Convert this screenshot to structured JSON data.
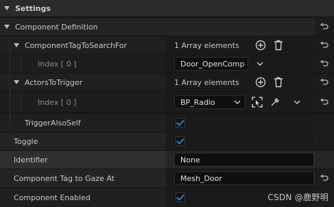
{
  "settings": {
    "title": "Settings"
  },
  "rows": {
    "component_definition": {
      "label": "Component Definition"
    },
    "tag_to_search": {
      "label": "ComponentTagToSearchFor",
      "summary": "1 Array elements"
    },
    "tag_index0": {
      "label": "Index [ 0 ]",
      "value": "Door_OpenComp"
    },
    "actors_to_trigger": {
      "label": "ActorsToTrigger",
      "summary": "1 Array elements"
    },
    "actor_index0": {
      "label": "Index [ 0 ]",
      "value": "BP_Radio"
    },
    "trigger_also_self": {
      "label": "TriggerAlsoSelf",
      "checked": true
    },
    "toggle": {
      "label": "Toggle",
      "checked": true
    },
    "identifier": {
      "label": "Identifier",
      "value": "None"
    },
    "component_tag_gaze": {
      "label": "Component Tag to Gaze At",
      "value": "Mesh_Door"
    },
    "component_enabled": {
      "label": "Component Enabled",
      "checked": true
    }
  },
  "watermark": "CSDN @鹿野明",
  "colors": {
    "accent": "#2a82e4",
    "background": "#151515"
  }
}
